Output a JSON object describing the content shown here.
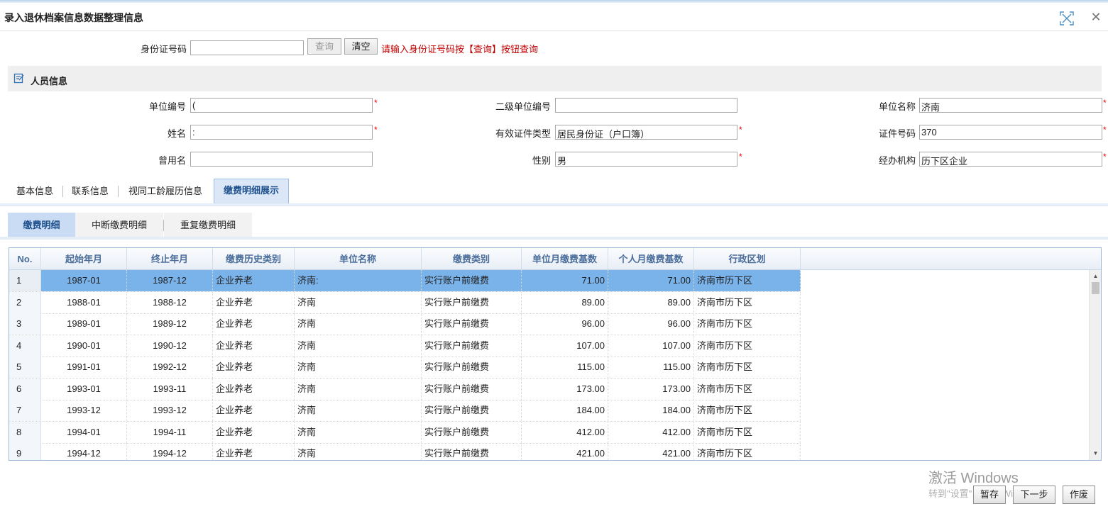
{
  "window": {
    "title": "录入退休档案信息数据整理信息"
  },
  "search": {
    "id_label": "身份证号码",
    "id_value": "",
    "query_label": "查询",
    "clear_label": "清空",
    "hint": "请输入身份证号码按【查询】按钮查询"
  },
  "person": {
    "section_title": "人员信息",
    "unit_no_label": "单位编号",
    "unit_no_value": "(",
    "sub_unit_no_label": "二级单位编号",
    "sub_unit_no_value": "",
    "unit_name_label": "单位名称",
    "unit_name_value": "济南",
    "name_label": "姓名",
    "name_value": ":",
    "id_type_label": "有效证件类型",
    "id_type_value": "居民身份证（户口簿）",
    "id_no_label": "证件号码",
    "id_no_value": "370",
    "former_name_label": "曾用名",
    "former_name_value": "",
    "gender_label": "性别",
    "gender_value": "男",
    "agency_label": "经办机构",
    "agency_value": "历下区企业",
    "required_mark": "*"
  },
  "tabs": [
    "基本信息",
    "联系信息",
    "视同工龄履历信息",
    "缴费明细展示"
  ],
  "subtabs": [
    "缴费明细",
    "中断缴费明细",
    "重复缴费明细"
  ],
  "grid": {
    "columns": [
      "No.",
      "起始年月",
      "终止年月",
      "缴费历史类别",
      "单位名称",
      "缴费类别",
      "单位月缴费基数",
      "个人月缴费基数",
      "行政区划"
    ],
    "rows": [
      [
        "1",
        "1987-01",
        "1987-12",
        "企业养老",
        "济南:",
        "实行账户前缴费",
        "71.00",
        "71.00",
        "济南市历下区"
      ],
      [
        "2",
        "1988-01",
        "1988-12",
        "企业养老",
        "济南",
        "实行账户前缴费",
        "89.00",
        "89.00",
        "济南市历下区"
      ],
      [
        "3",
        "1989-01",
        "1989-12",
        "企业养老",
        "济南",
        "实行账户前缴费",
        "96.00",
        "96.00",
        "济南市历下区"
      ],
      [
        "4",
        "1990-01",
        "1990-12",
        "企业养老",
        "济南",
        "实行账户前缴费",
        "107.00",
        "107.00",
        "济南市历下区"
      ],
      [
        "5",
        "1991-01",
        "1992-12",
        "企业养老",
        "济南",
        "实行账户前缴费",
        "115.00",
        "115.00",
        "济南市历下区"
      ],
      [
        "6",
        "1993-01",
        "1993-11",
        "企业养老",
        "济南",
        "实行账户前缴费",
        "173.00",
        "173.00",
        "济南市历下区"
      ],
      [
        "7",
        "1993-12",
        "1993-12",
        "企业养老",
        "济南",
        "实行账户前缴费",
        "184.00",
        "184.00",
        "济南市历下区"
      ],
      [
        "8",
        "1994-01",
        "1994-11",
        "企业养老",
        "济南",
        "实行账户前缴费",
        "412.00",
        "412.00",
        "济南市历下区"
      ],
      [
        "9",
        "1994-12",
        "1994-12",
        "企业养老",
        "济南",
        "实行账户前缴费",
        "421.00",
        "421.00",
        "济南市历下区"
      ]
    ]
  },
  "watermark": {
    "line1": "激活 Windows",
    "line2": "转到\"设置\"以激活 Windows。"
  },
  "footer": {
    "pause_label": "暂存",
    "next_label": "下一步",
    "void_label": "作废"
  }
}
